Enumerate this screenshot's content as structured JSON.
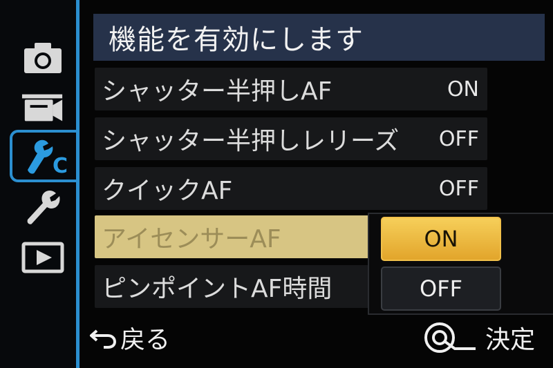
{
  "header": {
    "title": "機能を有効にします"
  },
  "sidebar": {
    "items": [
      {
        "icon": "camera-icon"
      },
      {
        "icon": "video-camera-icon"
      },
      {
        "icon": "custom-settings-icon",
        "label": "C",
        "active": true
      },
      {
        "icon": "wrench-icon"
      },
      {
        "icon": "playback-icon"
      }
    ]
  },
  "menu": {
    "rows": [
      {
        "label": "シャッター半押しAF",
        "value": "ON"
      },
      {
        "label": "シャッター半押しレリーズ",
        "value": "OFF"
      },
      {
        "label": "クイックAF",
        "value": "OFF"
      },
      {
        "label": "アイセンサーAF",
        "value": "",
        "selected": true
      },
      {
        "label": "ピンポイントAF時間",
        "value": ""
      }
    ]
  },
  "popup": {
    "options": [
      {
        "label": "ON",
        "selected": true
      },
      {
        "label": "OFF",
        "selected": false
      }
    ]
  },
  "footer": {
    "back_label": "戻る",
    "ok_label": "決定"
  },
  "colors": {
    "accent": "#2b8fd0",
    "header_bg": "#26324a",
    "selected_row": "#d7c583",
    "option_selected": "#f0bc3c"
  }
}
